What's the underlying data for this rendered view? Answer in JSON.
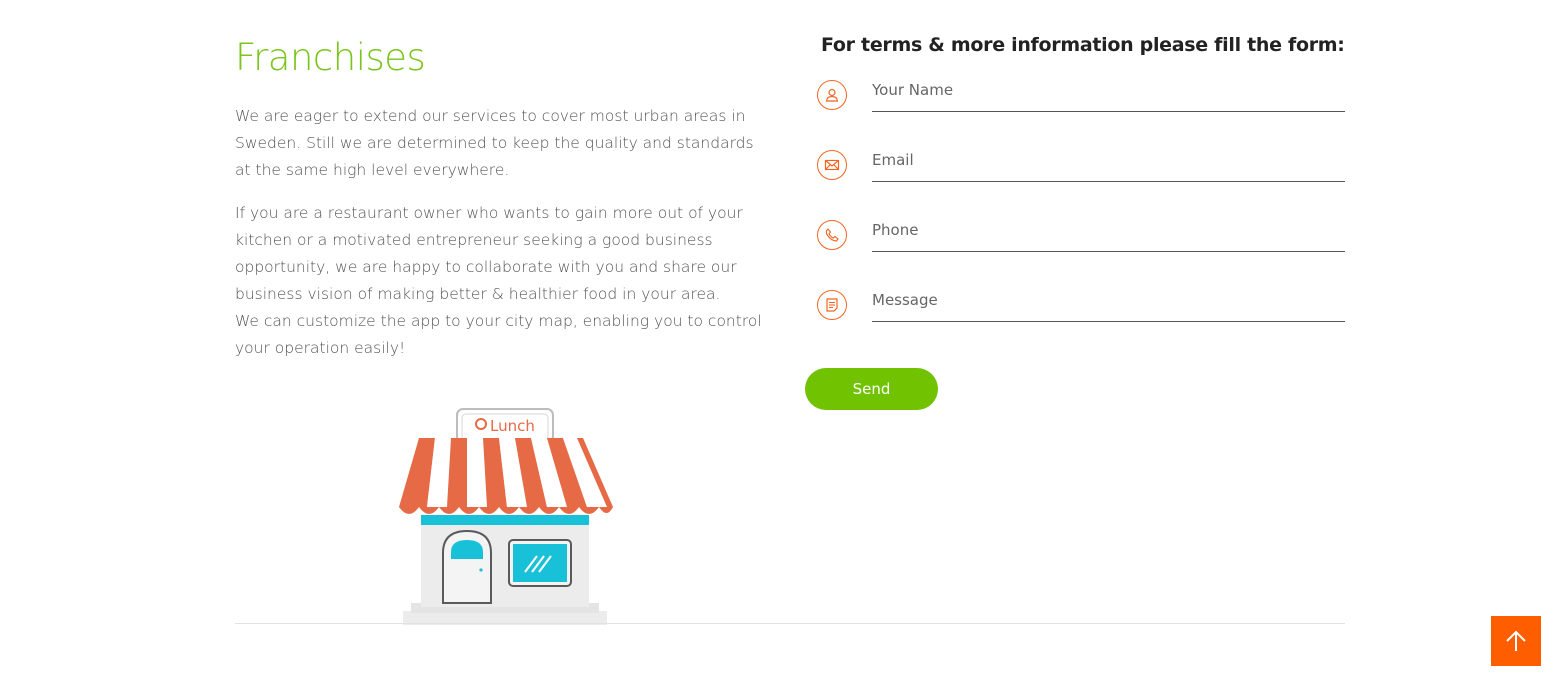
{
  "section": {
    "title": "Franchises",
    "paragraph1": "We are eager to extend our services to cover most urban areas in Sweden. Still we are determined to keep the quality and standards at the same high level everywhere.",
    "paragraph2": "If you are a restaurant owner who wants to gain more out of your kitchen or a motivated entrepreneur seeking a good business opportunity, we are happy to collaborate with you and share our business vision of making better & healthier food in your area.",
    "paragraph3": "We can customize the app to your city map, enabling you to control your operation easily!",
    "store_sign": "Lunch"
  },
  "form": {
    "heading": "For terms & more information please fill the form:",
    "fields": [
      {
        "placeholder": "Your Name",
        "value": "",
        "icon": "user-icon"
      },
      {
        "placeholder": "Email",
        "value": "",
        "icon": "envelope-icon"
      },
      {
        "placeholder": "Phone",
        "value": "",
        "icon": "phone-icon"
      },
      {
        "placeholder": "Message",
        "value": "",
        "icon": "message-icon"
      }
    ],
    "send_label": "Send"
  },
  "back_to_top": {
    "icon": "arrow-up-icon"
  },
  "colors": {
    "accent_green": "#71c200",
    "title_green": "#7ac51a",
    "accent_orange": "#f26522",
    "back_to_top_bg": "#ff5e00",
    "awning_red": "#e66a45",
    "store_teal": "#19c1d8"
  }
}
